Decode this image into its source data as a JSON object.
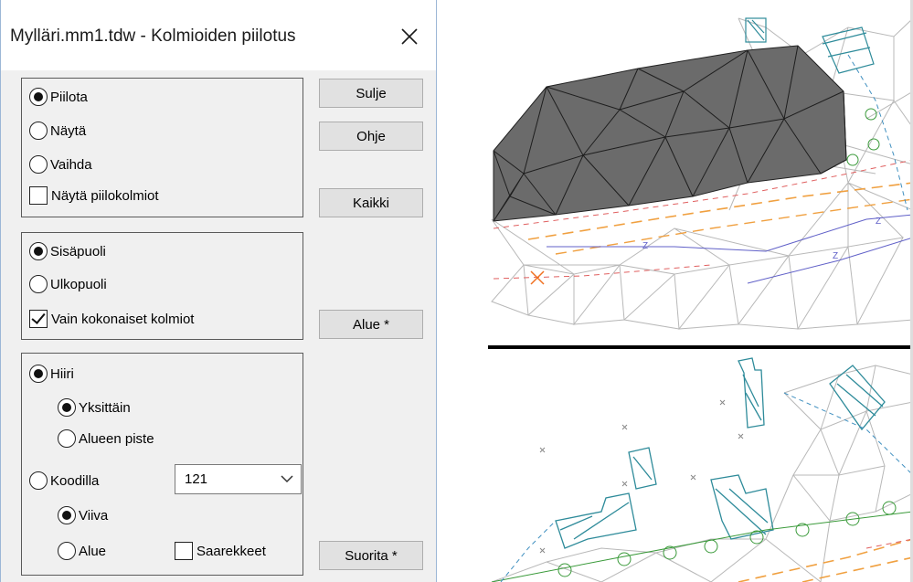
{
  "dialog": {
    "title": "Mylläri.mm1.tdw - Kolmioiden piilotus",
    "action_group": {
      "options": [
        {
          "label": "Piilota",
          "selected": true
        },
        {
          "label": "Näytä",
          "selected": false
        },
        {
          "label": "Vaihda",
          "selected": false
        }
      ],
      "show_hidden": {
        "label": "Näytä piilokolmiot",
        "checked": false
      }
    },
    "side_group": {
      "options": [
        {
          "label": "Sisäpuoli",
          "selected": true
        },
        {
          "label": "Ulkopuoli",
          "selected": false
        }
      ],
      "whole_only": {
        "label": "Vain kokonaiset kolmiot",
        "checked": true
      }
    },
    "selection_group": {
      "mouse": {
        "label": "Hiiri",
        "selected": true
      },
      "mouse_modes": [
        {
          "label": "Yksittäin",
          "selected": true
        },
        {
          "label": "Alueen piste",
          "selected": false
        }
      ],
      "by_code": {
        "label": "Koodilla",
        "selected": false
      },
      "code_value": "121",
      "code_modes": [
        {
          "label": "Viiva",
          "selected": true
        },
        {
          "label": "Alue",
          "selected": false
        }
      ],
      "islands": {
        "label": "Saarekkeet",
        "checked": false
      }
    },
    "buttons": {
      "close": "Sulje",
      "help": "Ohje",
      "all": "Kaikki",
      "area": "Alue *",
      "execute": "Suorita *"
    }
  },
  "map": {
    "line_label": "Z",
    "hidden_fill_color": "#6b6b6b",
    "triangle_line_color": "#b8b8b8",
    "building_color": "#2e8b9a",
    "divider_color": "#000000"
  }
}
